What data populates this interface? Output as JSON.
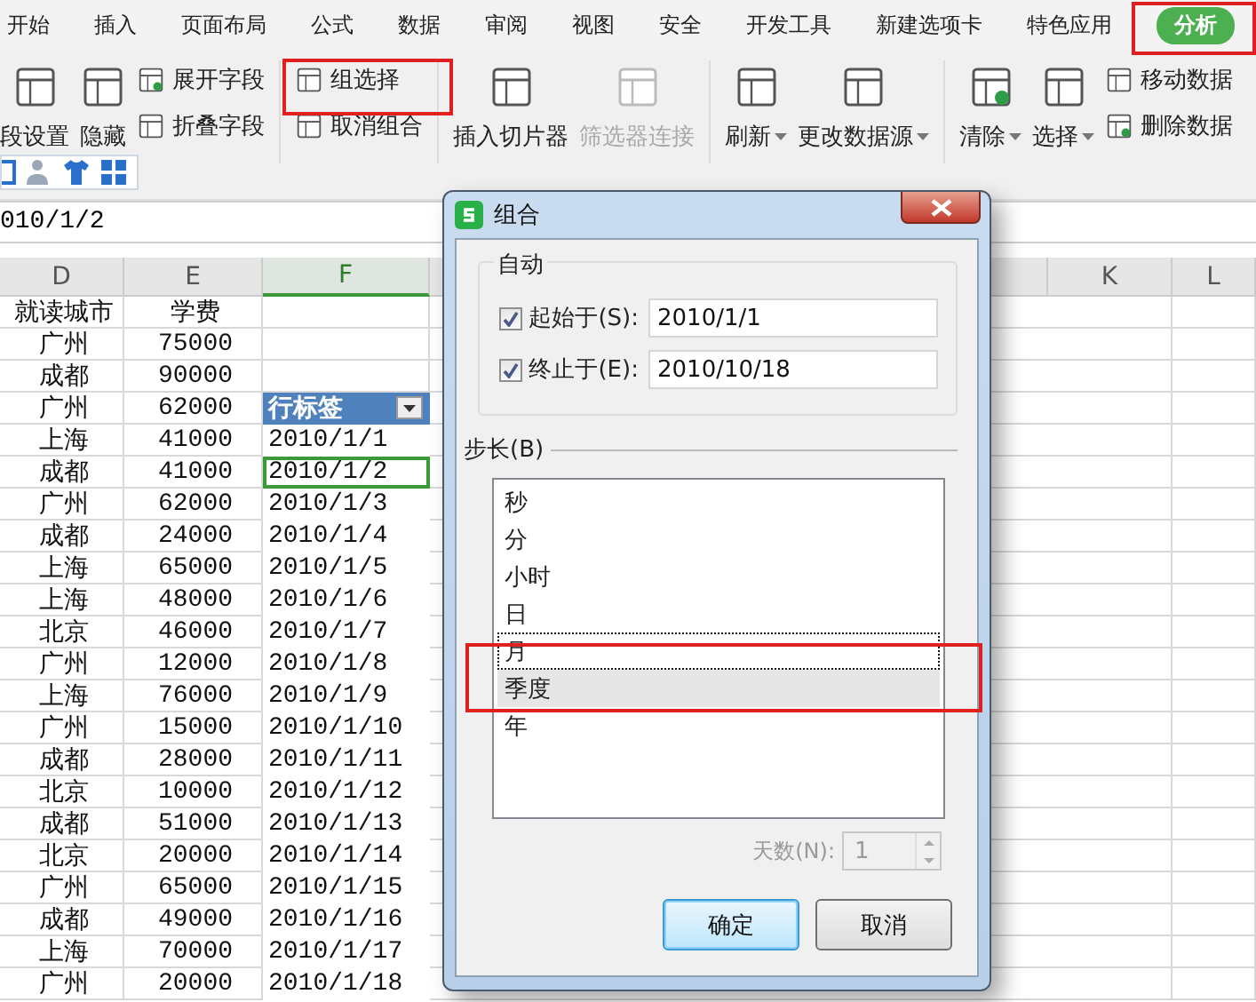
{
  "menu_tabs": [
    {
      "label": "开始",
      "selected": false
    },
    {
      "label": "插入",
      "selected": false
    },
    {
      "label": "页面布局",
      "selected": false
    },
    {
      "label": "公式",
      "selected": false
    },
    {
      "label": "数据",
      "selected": false
    },
    {
      "label": "审阅",
      "selected": false
    },
    {
      "label": "视图",
      "selected": false
    },
    {
      "label": "安全",
      "selected": false
    },
    {
      "label": "开发工具",
      "selected": false
    },
    {
      "label": "新建选项卡",
      "selected": false
    },
    {
      "label": "特色应用",
      "selected": false
    },
    {
      "label": "分析",
      "selected": true
    }
  ],
  "ribbon_groups": [
    {
      "items": [
        {
          "kind": "large",
          "label": "段设置",
          "disabled": false,
          "dropdown": false
        },
        {
          "kind": "large",
          "label": "隐藏",
          "disabled": false,
          "dropdown": false
        },
        {
          "kind": "stack",
          "items": [
            {
              "label": "展开字段",
              "disabled": false
            },
            {
              "label": "折叠字段",
              "disabled": false
            }
          ]
        }
      ]
    },
    {
      "items": [
        {
          "kind": "stack",
          "items": [
            {
              "label": "组选择",
              "disabled": false
            },
            {
              "label": "取消组合",
              "disabled": false
            }
          ]
        }
      ]
    },
    {
      "items": [
        {
          "kind": "large",
          "label": "插入切片器",
          "disabled": false,
          "dropdown": false
        },
        {
          "kind": "large",
          "label": "筛选器连接",
          "disabled": true,
          "dropdown": false
        }
      ]
    },
    {
      "items": [
        {
          "kind": "large",
          "label": "刷新",
          "disabled": false,
          "dropdown": true
        },
        {
          "kind": "large",
          "label": "更改数据源",
          "disabled": false,
          "dropdown": true
        }
      ]
    },
    {
      "items": [
        {
          "kind": "large",
          "label": "清除",
          "disabled": false,
          "dropdown": true
        },
        {
          "kind": "large",
          "label": "选择",
          "disabled": false,
          "dropdown": true
        },
        {
          "kind": "stack",
          "items": [
            {
              "label": "移动数据",
              "disabled": false
            },
            {
              "label": "删除数据",
              "disabled": false
            }
          ]
        }
      ]
    }
  ],
  "formula_bar": {
    "value": "010/1/2"
  },
  "columns": [
    {
      "label": "D",
      "selected": false
    },
    {
      "label": "E",
      "selected": false
    },
    {
      "label": "F",
      "selected": true
    },
    {
      "label": "K",
      "selected": false
    },
    {
      "label": "L",
      "selected": false
    }
  ],
  "rows": [
    {
      "city": "就读城市",
      "fee": "学费",
      "selected": false
    },
    {
      "city": "广州",
      "fee": "75000",
      "selected": false
    },
    {
      "city": "成都",
      "fee": "90000",
      "selected": false
    },
    {
      "city": "广州",
      "fee": "62000",
      "label": "行标签",
      "kind": "header",
      "selected": false
    },
    {
      "city": "上海",
      "fee": "41000",
      "label": "2010/1/1",
      "selected": false
    },
    {
      "city": "成都",
      "fee": "41000",
      "label": "2010/1/2",
      "selected": true
    },
    {
      "city": "广州",
      "fee": "62000",
      "label": "2010/1/3",
      "selected": false
    },
    {
      "city": "成都",
      "fee": "24000",
      "label": "2010/1/4",
      "selected": false
    },
    {
      "city": "上海",
      "fee": "65000",
      "label": "2010/1/5",
      "selected": false
    },
    {
      "city": "上海",
      "fee": "48000",
      "label": "2010/1/6",
      "selected": false
    },
    {
      "city": "北京",
      "fee": "46000",
      "label": "2010/1/7",
      "selected": false
    },
    {
      "city": "广州",
      "fee": "12000",
      "label": "2010/1/8",
      "selected": false
    },
    {
      "city": "上海",
      "fee": "76000",
      "label": "2010/1/9",
      "selected": false
    },
    {
      "city": "广州",
      "fee": "15000",
      "label": "2010/1/10",
      "selected": false
    },
    {
      "city": "成都",
      "fee": "28000",
      "label": "2010/1/11",
      "selected": false
    },
    {
      "city": "北京",
      "fee": "10000",
      "label": "2010/1/12",
      "selected": false
    },
    {
      "city": "成都",
      "fee": "51000",
      "label": "2010/1/13",
      "selected": false
    },
    {
      "city": "北京",
      "fee": "20000",
      "label": "2010/1/14",
      "selected": false
    },
    {
      "city": "广州",
      "fee": "65000",
      "label": "2010/1/15",
      "selected": false
    },
    {
      "city": "成都",
      "fee": "49000",
      "label": "2010/1/16",
      "selected": false
    },
    {
      "city": "上海",
      "fee": "70000",
      "label": "2010/1/17",
      "selected": false
    },
    {
      "city": "广州",
      "fee": "20000",
      "label": "2010/1/18",
      "selected": false
    }
  ],
  "dialog": {
    "title": "组合",
    "group_title": "自动",
    "fields": [
      {
        "label": "起始于(S):",
        "checked": true,
        "value": "2010/1/1"
      },
      {
        "label": "终止于(E):",
        "checked": true,
        "value": "2010/10/18"
      }
    ],
    "step_label": "步长(B)",
    "step_items": [
      {
        "label": "秒",
        "selected": false,
        "focused": false
      },
      {
        "label": "分",
        "selected": false,
        "focused": false
      },
      {
        "label": "小时",
        "selected": false,
        "focused": false
      },
      {
        "label": "日",
        "selected": false,
        "focused": false
      },
      {
        "label": "月",
        "selected": false,
        "focused": true
      },
      {
        "label": "季度",
        "selected": true,
        "focused": false
      },
      {
        "label": "年",
        "selected": false,
        "focused": false
      }
    ],
    "days": {
      "label": "天数(N):",
      "value": "1",
      "disabled": true
    },
    "buttons": [
      {
        "label": "确定",
        "kind": "default"
      },
      {
        "label": "取消",
        "kind": "normal"
      }
    ]
  }
}
